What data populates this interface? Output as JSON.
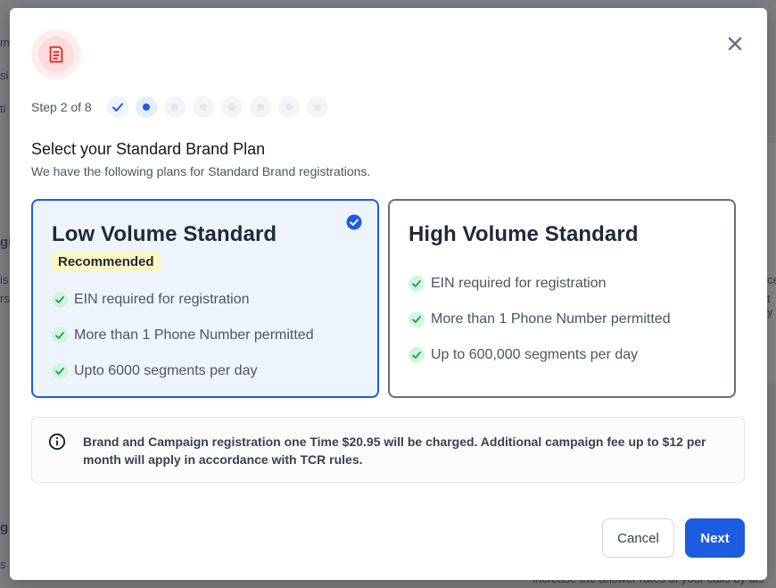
{
  "background": {
    "fragments": [
      "mp",
      "si",
      "ti",
      "gi",
      "is",
      "rs",
      "ce",
      "t y",
      "g",
      "s b",
      "increase the answer rates of your calls by dis"
    ]
  },
  "modal": {
    "header_icon": "document-icon",
    "close_icon": "close-icon",
    "step_label": "Step 2 of 8",
    "steps": [
      {
        "state": "done"
      },
      {
        "state": "current"
      },
      {
        "state": "upcoming"
      },
      {
        "state": "upcoming"
      },
      {
        "state": "upcoming"
      },
      {
        "state": "upcoming"
      },
      {
        "state": "upcoming"
      },
      {
        "state": "upcoming"
      }
    ],
    "title": "Select your Standard Brand Plan",
    "subtitle": "We have the following plans for Standard Brand registrations.",
    "plans": [
      {
        "name": "Low Volume Standard",
        "badge": "Recommended",
        "selected": true,
        "features": [
          "EIN required for registration",
          "More than 1 Phone Number permitted",
          "Upto 6000 segments per day"
        ]
      },
      {
        "name": "High Volume Standard",
        "selected": false,
        "features": [
          "EIN required for registration",
          "More than 1 Phone Number permitted",
          "Up to 600,000 segments per day"
        ]
      }
    ],
    "info": {
      "icon": "info-icon",
      "text": "Brand and Campaign registration one Time $20.95 will be charged. Additional campaign fee up to $12 per month will apply in accordance with TCR rules."
    },
    "buttons": {
      "cancel": "Cancel",
      "next": "Next"
    }
  },
  "colors": {
    "accent": "#1d5ce0",
    "selected_bg": "#edf4fe",
    "check_green": "#16a34a",
    "badge_bg": "#fef6c5",
    "icon_red": "#d92d20"
  }
}
